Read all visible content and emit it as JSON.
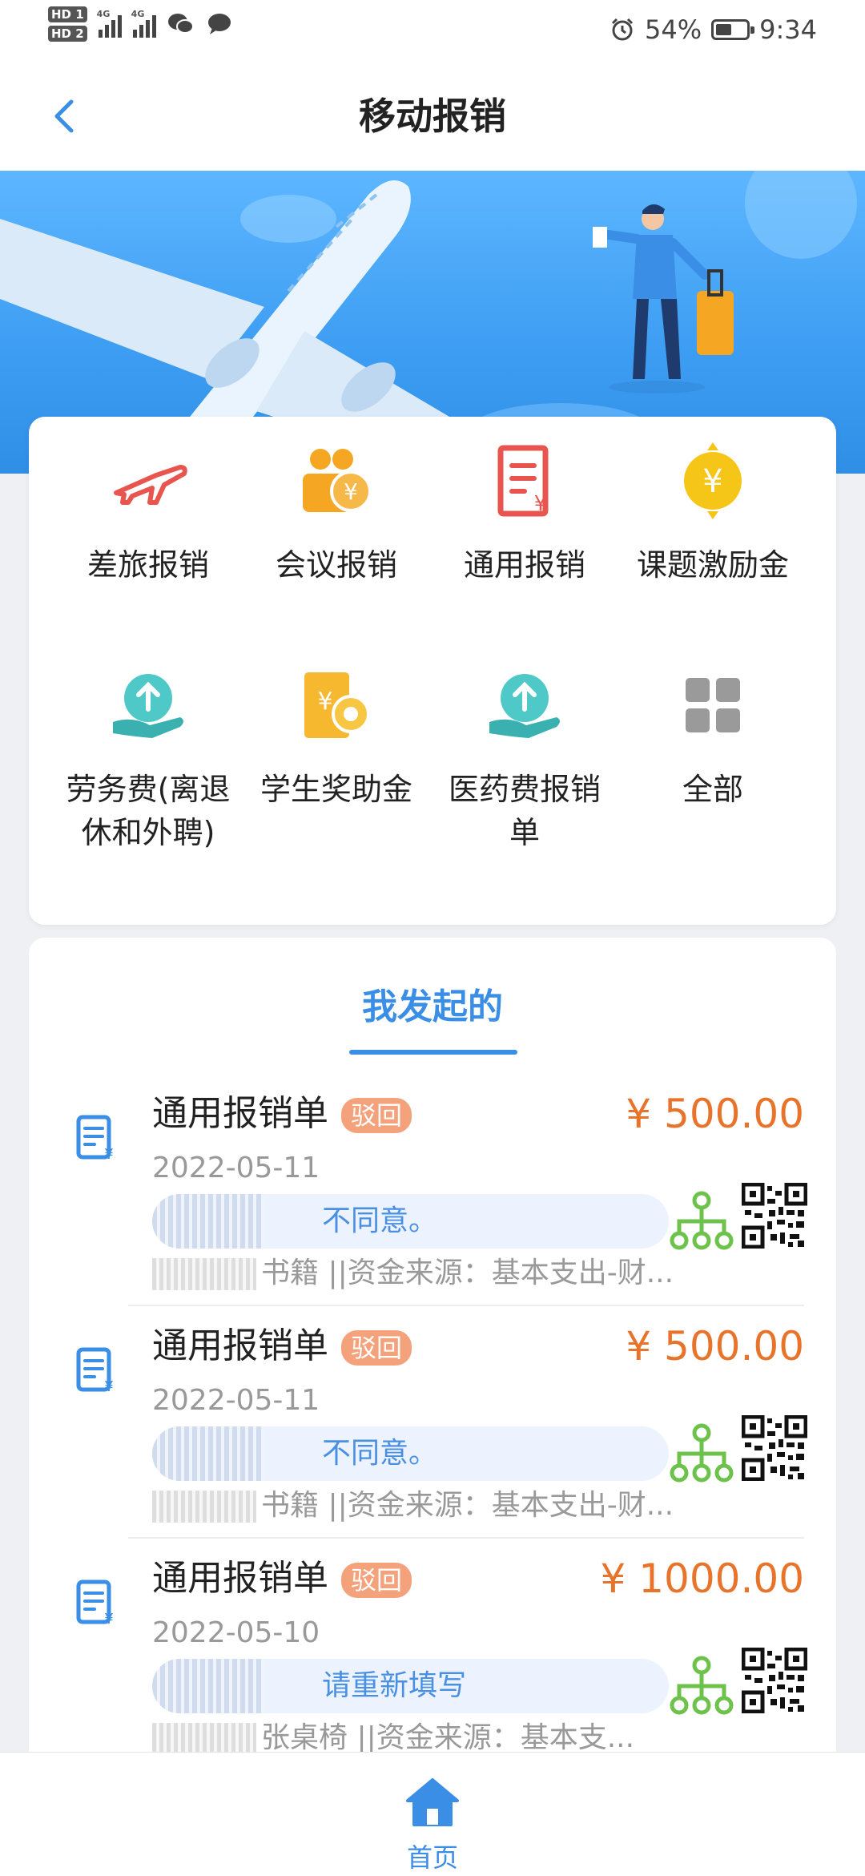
{
  "status_bar": {
    "hd1": "HD 1",
    "hd2": "HD 2",
    "net1": "4G",
    "net2": "4G",
    "battery_text": "54%",
    "battery_level": 0.54,
    "time": "9:34"
  },
  "header": {
    "title": "移动报销"
  },
  "menu": {
    "items": [
      {
        "label": "差旅报销",
        "icon": "airplane-icon"
      },
      {
        "label": "会议报销",
        "icon": "meeting-icon"
      },
      {
        "label": "通用报销",
        "icon": "document-yuan-icon"
      },
      {
        "label": "课题激励金",
        "icon": "gold-coin-icon"
      },
      {
        "label": "劳务费(离退休和外聘)",
        "icon": "hand-upload-icon"
      },
      {
        "label": "学生奖助金",
        "icon": "award-yuan-icon"
      },
      {
        "label": "医药费报销单",
        "icon": "hand-upload-icon"
      },
      {
        "label": "全部",
        "icon": "grid-icon"
      }
    ]
  },
  "list": {
    "tab": "我发起的",
    "rows": [
      {
        "title": "通用报销单",
        "status": "驳回",
        "amount": "¥ 500.00",
        "date": "2022-05-11",
        "comment": "不同意。",
        "desc": "书籍 ||资金来源：基本支出-财..."
      },
      {
        "title": "通用报销单",
        "status": "驳回",
        "amount": "¥ 500.00",
        "date": "2022-05-11",
        "comment": "不同意。",
        "desc": "书籍 ||资金来源：基本支出-财..."
      },
      {
        "title": "通用报销单",
        "status": "驳回",
        "amount": "¥ 1000.00",
        "date": "2022-05-10",
        "comment": "请重新填写",
        "desc": "张桌椅 ||资金来源：基本支..."
      }
    ]
  },
  "bottom_nav": {
    "home_label": "首页"
  },
  "colors": {
    "accent": "#3a8ee6",
    "amount": "#e8742c",
    "status_badge": "#f4a27b",
    "flow_icon": "#6cc24a"
  }
}
